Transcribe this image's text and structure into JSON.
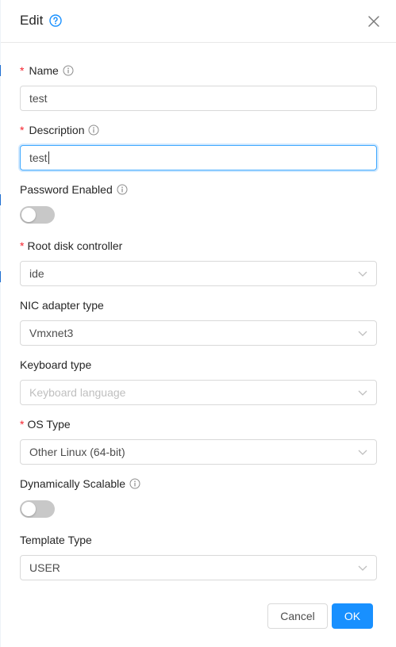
{
  "modal": {
    "title": "Edit",
    "close_icon": "close-icon",
    "help_icon": "question-circle-icon"
  },
  "form": {
    "name": {
      "label": "Name",
      "required": true,
      "value": "test"
    },
    "description": {
      "label": "Description",
      "required": true,
      "value": "test"
    },
    "password_enabled": {
      "label": "Password Enabled",
      "checked": false
    },
    "root_disk_controller": {
      "label": "Root disk controller",
      "required": true,
      "value": "ide"
    },
    "nic_adapter_type": {
      "label": "NIC adapter type",
      "value": "Vmxnet3"
    },
    "keyboard_type": {
      "label": "Keyboard type",
      "placeholder": "Keyboard language"
    },
    "os_type": {
      "label": "OS Type",
      "required": true,
      "value": "Other Linux (64-bit)"
    },
    "dynamically_scalable": {
      "label": "Dynamically Scalable",
      "checked": false
    },
    "template_type": {
      "label": "Template Type",
      "value": "USER"
    }
  },
  "footer": {
    "cancel_label": "Cancel",
    "ok_label": "OK"
  },
  "colors": {
    "primary": "#1890ff",
    "required": "#f5222d",
    "focus_border": "#40a9ff"
  }
}
